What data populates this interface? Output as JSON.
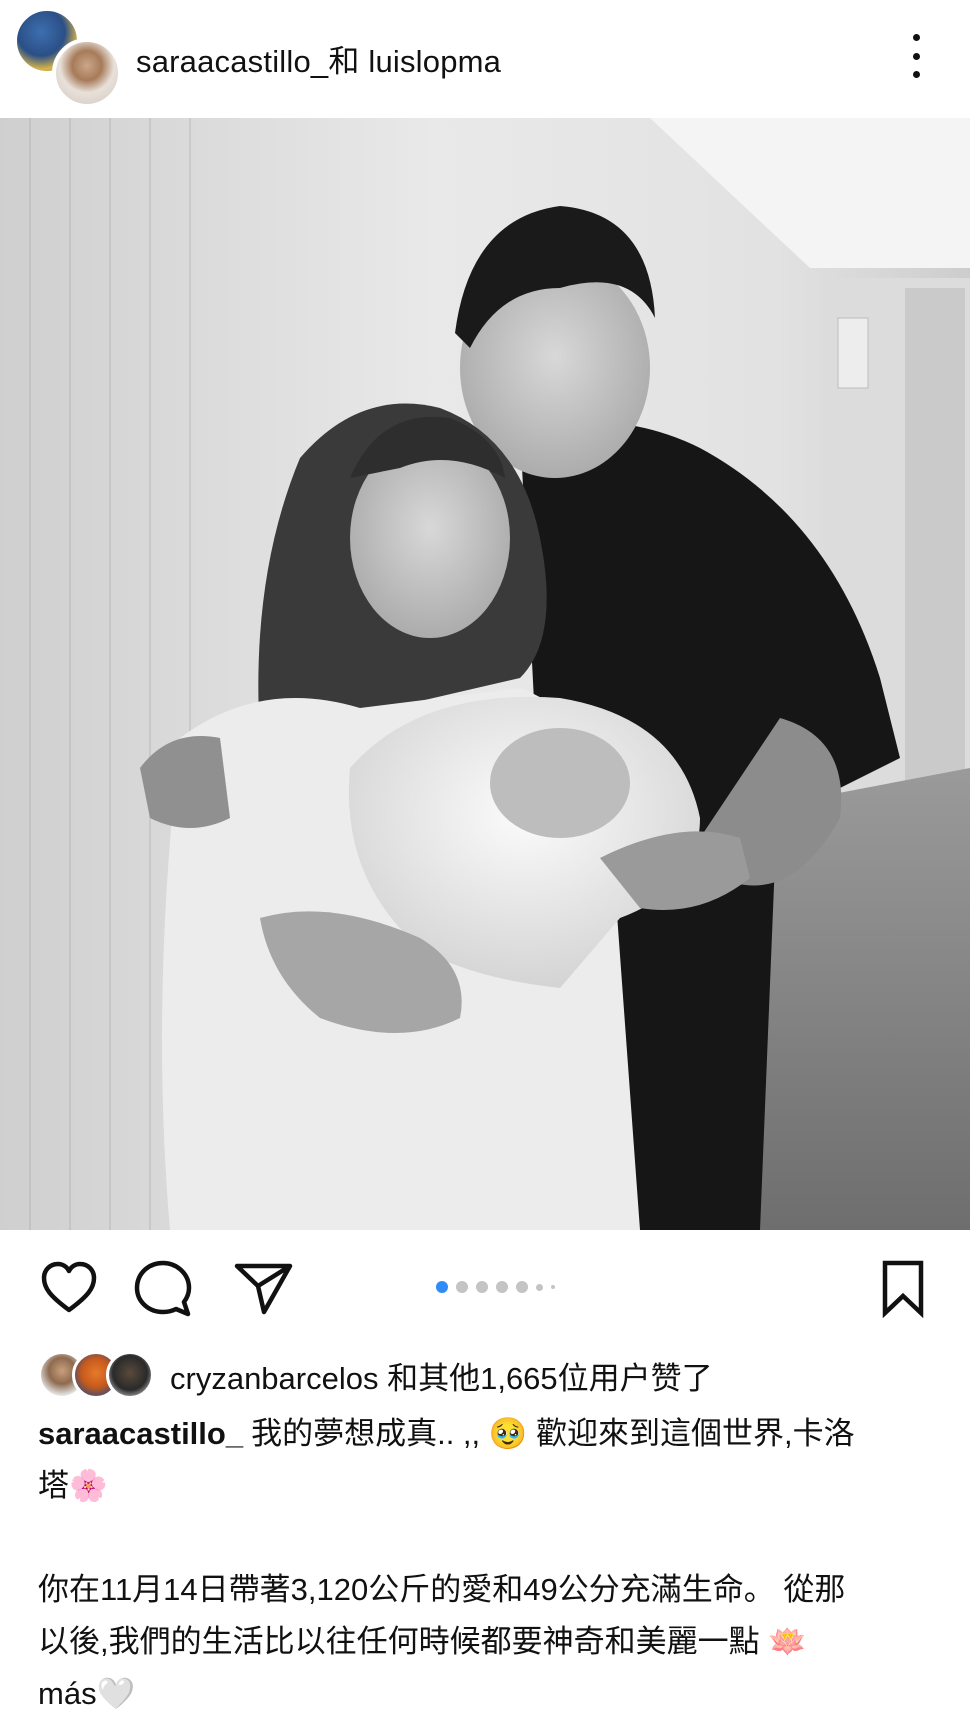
{
  "header": {
    "title": "saraacastillo_和 luislopma",
    "more_icon": "more-vertical-icon"
  },
  "photo": {
    "icon": "post-photo"
  },
  "actions": {
    "like_icon": "heart-icon",
    "comment_icon": "comment-icon",
    "share_icon": "send-icon",
    "save_icon": "bookmark-icon",
    "carousel_active_index": 1,
    "accent_color": "#2f8cf6"
  },
  "likes": {
    "text": "cryzanbarcelos 和其他1,665位用户赞了"
  },
  "caption": {
    "username": "saraacastillo_",
    "line1": "我的夢想成真.. ,, 🥹 歡迎來到這個世界,卡洛",
    "line2": "塔🌸",
    "line3": "你在11月14日帶著3,120公斤的愛和49公分充滿生命。 從那",
    "line4": "以後,我們的生活比以往任何時候都要神奇和美麗一點 🪷",
    "line5": "más🤍"
  }
}
